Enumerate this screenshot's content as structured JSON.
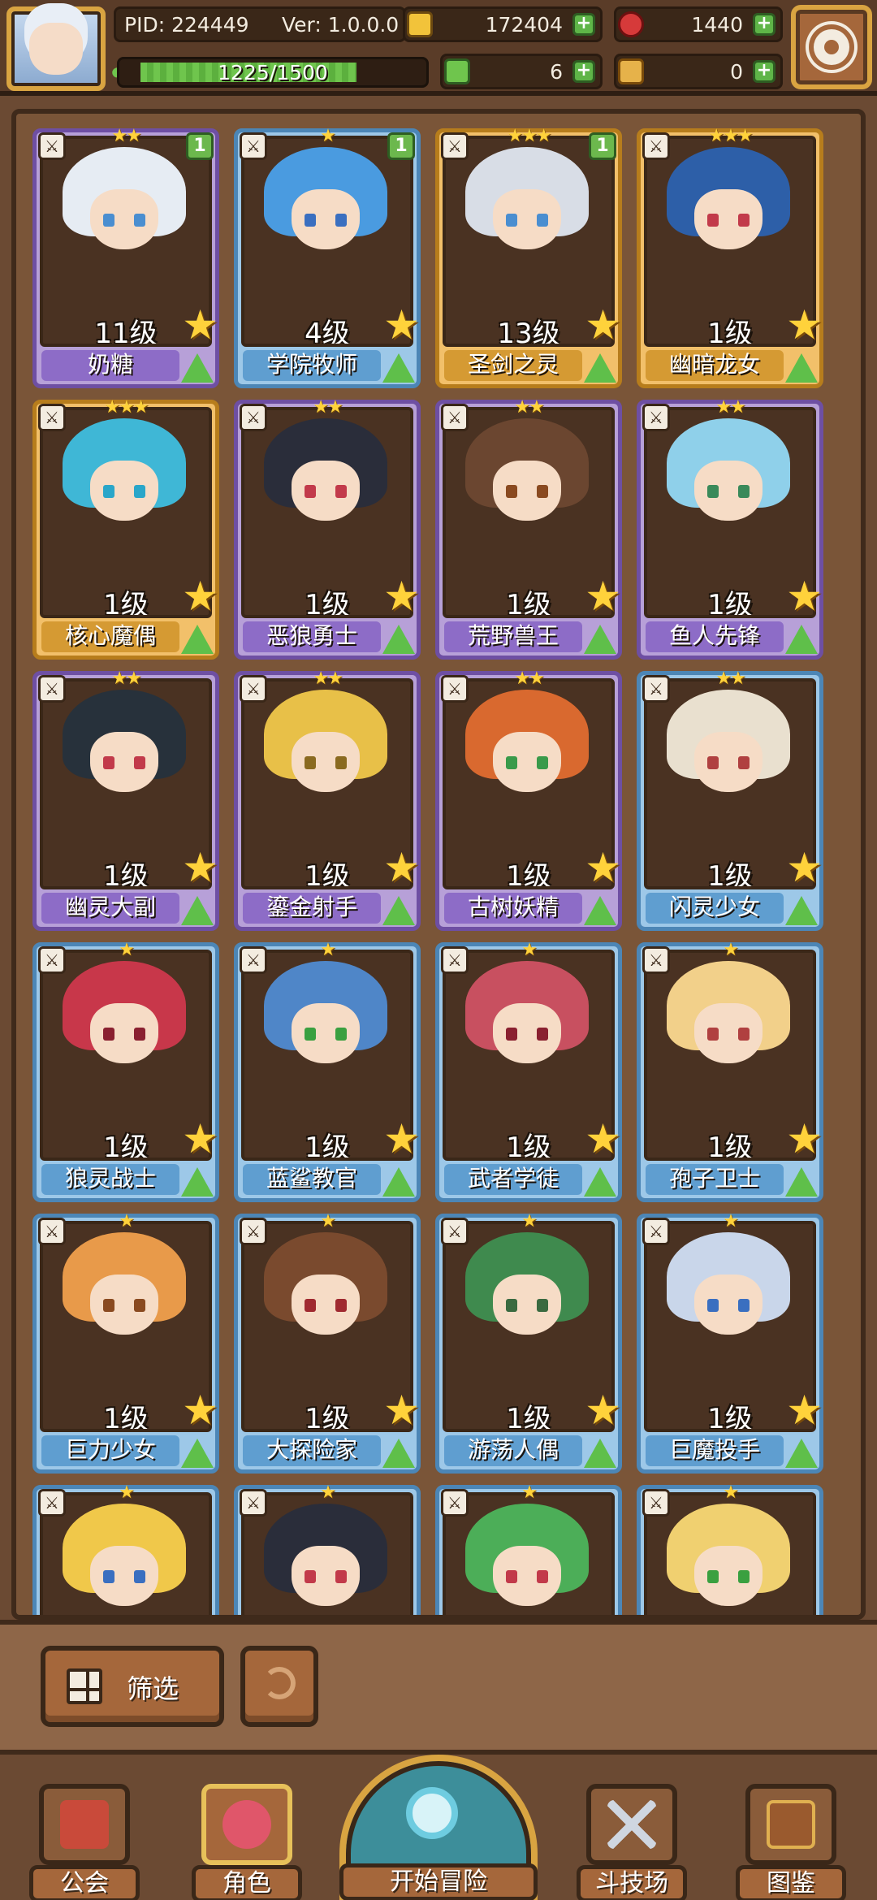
{
  "hud": {
    "pid": "PID: 224449",
    "version": "Ver: 1.0.0.0",
    "gold": "172404",
    "gems": "1440",
    "xp_text": "1225/1500",
    "xp_fraction": 0.817,
    "clover": "6",
    "keys": "0"
  },
  "cards": [
    {
      "name": "奶糖",
      "level": "11级",
      "stars": "★★",
      "badge": "1",
      "rarity": "r1",
      "hair": "#e6ecf3",
      "eye": "#4a8ed0"
    },
    {
      "name": "学院牧师",
      "level": "4级",
      "stars": "★",
      "badge": "1",
      "rarity": "r3",
      "hair": "#4a9be0",
      "eye": "#3a6fc0"
    },
    {
      "name": "圣剑之灵",
      "level": "13级",
      "stars": "★★★",
      "badge": "1",
      "rarity": "r2",
      "hair": "#d8dde6",
      "eye": "#4a8ed0"
    },
    {
      "name": "幽暗龙女",
      "level": "1级",
      "stars": "★★★",
      "badge": "",
      "rarity": "r2",
      "hair": "#2d5fa8",
      "eye": "#c23a4a"
    },
    {
      "name": "核心魔偶",
      "level": "1级",
      "stars": "★★★",
      "badge": "",
      "rarity": "r2",
      "hair": "#3fb7d6",
      "eye": "#2aa6c9"
    },
    {
      "name": "恶狼勇士",
      "level": "1级",
      "stars": "★★",
      "badge": "",
      "rarity": "r1",
      "hair": "#2a2d3a",
      "eye": "#c23a4a"
    },
    {
      "name": "荒野兽王",
      "level": "1级",
      "stars": "★★",
      "badge": "",
      "rarity": "r1",
      "hair": "#6b4630",
      "eye": "#8a4a20"
    },
    {
      "name": "鱼人先锋",
      "level": "1级",
      "stars": "★★",
      "badge": "",
      "rarity": "r1",
      "hair": "#8fd0ea",
      "eye": "#3a8a5a"
    },
    {
      "name": "幽灵大副",
      "level": "1级",
      "stars": "★★",
      "badge": "",
      "rarity": "r1",
      "hair": "#27313b",
      "eye": "#c23a4a"
    },
    {
      "name": "鎏金射手",
      "level": "1级",
      "stars": "★★",
      "badge": "",
      "rarity": "r1",
      "hair": "#e8c048",
      "eye": "#8a6a20"
    },
    {
      "name": "古树妖精",
      "level": "1级",
      "stars": "★★",
      "badge": "",
      "rarity": "r1",
      "hair": "#d9692f",
      "eye": "#3a9a4a"
    },
    {
      "name": "闪灵少女",
      "level": "1级",
      "stars": "★★",
      "badge": "",
      "rarity": "r3",
      "hair": "#e9e0cf",
      "eye": "#b04040"
    },
    {
      "name": "狼灵战士",
      "level": "1级",
      "stars": "★",
      "badge": "",
      "rarity": "r3",
      "hair": "#c8374a",
      "eye": "#8a2030"
    },
    {
      "name": "蓝鲨教官",
      "level": "1级",
      "stars": "★",
      "badge": "",
      "rarity": "r3",
      "hair": "#4f86c8",
      "eye": "#3aa040"
    },
    {
      "name": "武者学徒",
      "level": "1级",
      "stars": "★",
      "badge": "",
      "rarity": "r3",
      "hair": "#c85060",
      "eye": "#8a2030"
    },
    {
      "name": "孢子卫士",
      "level": "1级",
      "stars": "★",
      "badge": "",
      "rarity": "r3",
      "hair": "#f2d08a",
      "eye": "#b04040"
    },
    {
      "name": "巨力少女",
      "level": "1级",
      "stars": "★",
      "badge": "",
      "rarity": "r3",
      "hair": "#e89a4a",
      "eye": "#8a4a20"
    },
    {
      "name": "大探险家",
      "level": "1级",
      "stars": "★",
      "badge": "",
      "rarity": "r3",
      "hair": "#7a4a2e",
      "eye": "#a02a30"
    },
    {
      "name": "游荡人偶",
      "level": "1级",
      "stars": "★",
      "badge": "",
      "rarity": "r3",
      "hair": "#3f8a4e",
      "eye": "#3a6a40"
    },
    {
      "name": "巨魔投手",
      "level": "1级",
      "stars": "★",
      "badge": "",
      "rarity": "r3",
      "hair": "#c9d6ea",
      "eye": "#3a6fc0"
    },
    {
      "name": "",
      "level": "",
      "stars": "★",
      "badge": "",
      "rarity": "r3",
      "hair": "#f0c84a",
      "eye": "#3a6fc0"
    },
    {
      "name": "",
      "level": "",
      "stars": "★",
      "badge": "",
      "rarity": "r3",
      "hair": "#2a2d3a",
      "eye": "#c23a4a"
    },
    {
      "name": "",
      "level": "",
      "stars": "★",
      "badge": "",
      "rarity": "r3",
      "hair": "#4cae58",
      "eye": "#c23a4a"
    },
    {
      "name": "",
      "level": "",
      "stars": "★",
      "badge": "",
      "rarity": "r3",
      "hair": "#f0d070",
      "eye": "#3aa040"
    }
  ],
  "controls": {
    "filter_label": "筛选"
  },
  "nav": [
    {
      "label": "公会",
      "icon": "guild-hall-icon"
    },
    {
      "label": "角色",
      "icon": "character-icon"
    },
    {
      "label": "开始冒险",
      "icon": "adventure-globe-icon"
    },
    {
      "label": "斗技场",
      "icon": "crossed-swords-icon"
    },
    {
      "label": "图鉴",
      "icon": "codex-book-icon"
    }
  ]
}
